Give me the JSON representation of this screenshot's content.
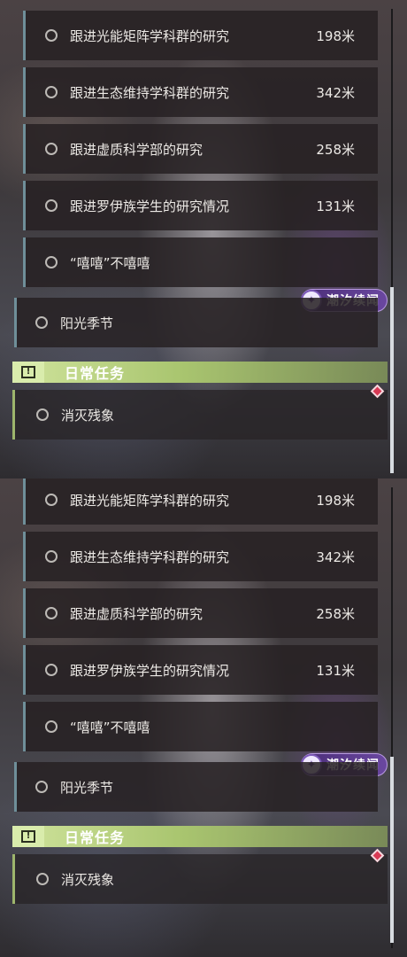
{
  "panels": [
    {
      "sub_quests": [
        {
          "label": "跟进光能矩阵学科群的研究",
          "distance": "198米"
        },
        {
          "label": "跟进生态维持学科群的研究",
          "distance": "342米"
        },
        {
          "label": "跟进虚质科学部的研究",
          "distance": "258米"
        },
        {
          "label": "跟进罗伊族学生的研究情况",
          "distance": "131米"
        },
        {
          "label": "“嘻嘻”不嘻嘻",
          "distance": ""
        }
      ],
      "event_tag": {
        "text": "潮汐续闻",
        "icon": "swirl-icon"
      },
      "main_quest": {
        "label": "阳光季节"
      },
      "daily_header": {
        "title": "日常任务",
        "icon": "exclamation-icon"
      },
      "daily_quest": {
        "label": "消灭残象"
      }
    },
    {
      "sub_quests": [
        {
          "label": "跟进光能矩阵学科群的研究",
          "distance": "198米"
        },
        {
          "label": "跟进生态维持学科群的研究",
          "distance": "342米"
        },
        {
          "label": "跟进虚质科学部的研究",
          "distance": "258米"
        },
        {
          "label": "跟进罗伊族学生的研究情况",
          "distance": "131米"
        },
        {
          "label": "“嘻嘻”不嘻嘻",
          "distance": ""
        }
      ],
      "event_tag": {
        "text": "潮汐续闻",
        "icon": "swirl-icon"
      },
      "main_quest": {
        "label": "阳光季节"
      },
      "daily_header": {
        "title": "日常任务",
        "icon": "exclamation-icon"
      },
      "daily_quest": {
        "label": "消灭残象"
      }
    }
  ],
  "colors": {
    "accent_daily": "#a9c56f",
    "accent_event": "#6a47a0",
    "quest_bar": "#6f8f99",
    "marker": "#d83a55"
  }
}
